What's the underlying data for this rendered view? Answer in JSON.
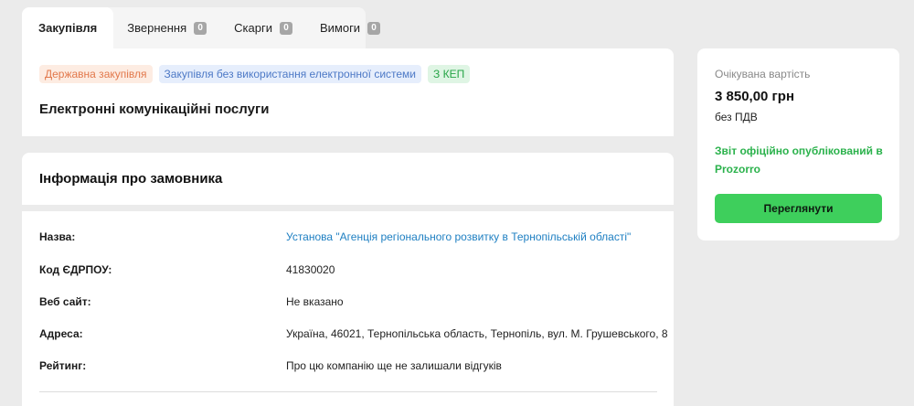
{
  "tabs": [
    {
      "label": "Закупівля",
      "count": null
    },
    {
      "label": "Звернення",
      "count": "0"
    },
    {
      "label": "Скарги",
      "count": "0"
    },
    {
      "label": "Вимоги",
      "count": "0"
    }
  ],
  "procurement": {
    "badges": [
      "Державна закупівля",
      "Закупівля без використання електронної системи",
      "З КЕП"
    ],
    "title": "Електронні комунікаційні послуги"
  },
  "customer": {
    "heading": "Інформація про замовника",
    "rows": [
      {
        "label": "Назва:",
        "value": "Установа \"Агенція регіонального розвитку в Тернопільській області\""
      },
      {
        "label": "Код ЄДРПОУ:",
        "value": "41830020"
      },
      {
        "label": "Веб сайт:",
        "value": "Не вказано"
      },
      {
        "label": "Адреса:",
        "value": "Україна, 46021, Тернопільська область, Тернопіль, вул. М. Грушевського, 8"
      },
      {
        "label": "Рейтинг:",
        "value": "Про цю компанію ще не залишали відгуків"
      }
    ]
  },
  "summary": {
    "caption": "Очікувана вартість",
    "amount": "3 850,00 грн",
    "vat": "без ПДВ",
    "report": "Звіт офіційно опублікований в Prozorro",
    "button": "Переглянути"
  },
  "colors": {
    "accent": "#3ecf5c",
    "link": "#1e7fc2",
    "report": "#2bb24c"
  }
}
